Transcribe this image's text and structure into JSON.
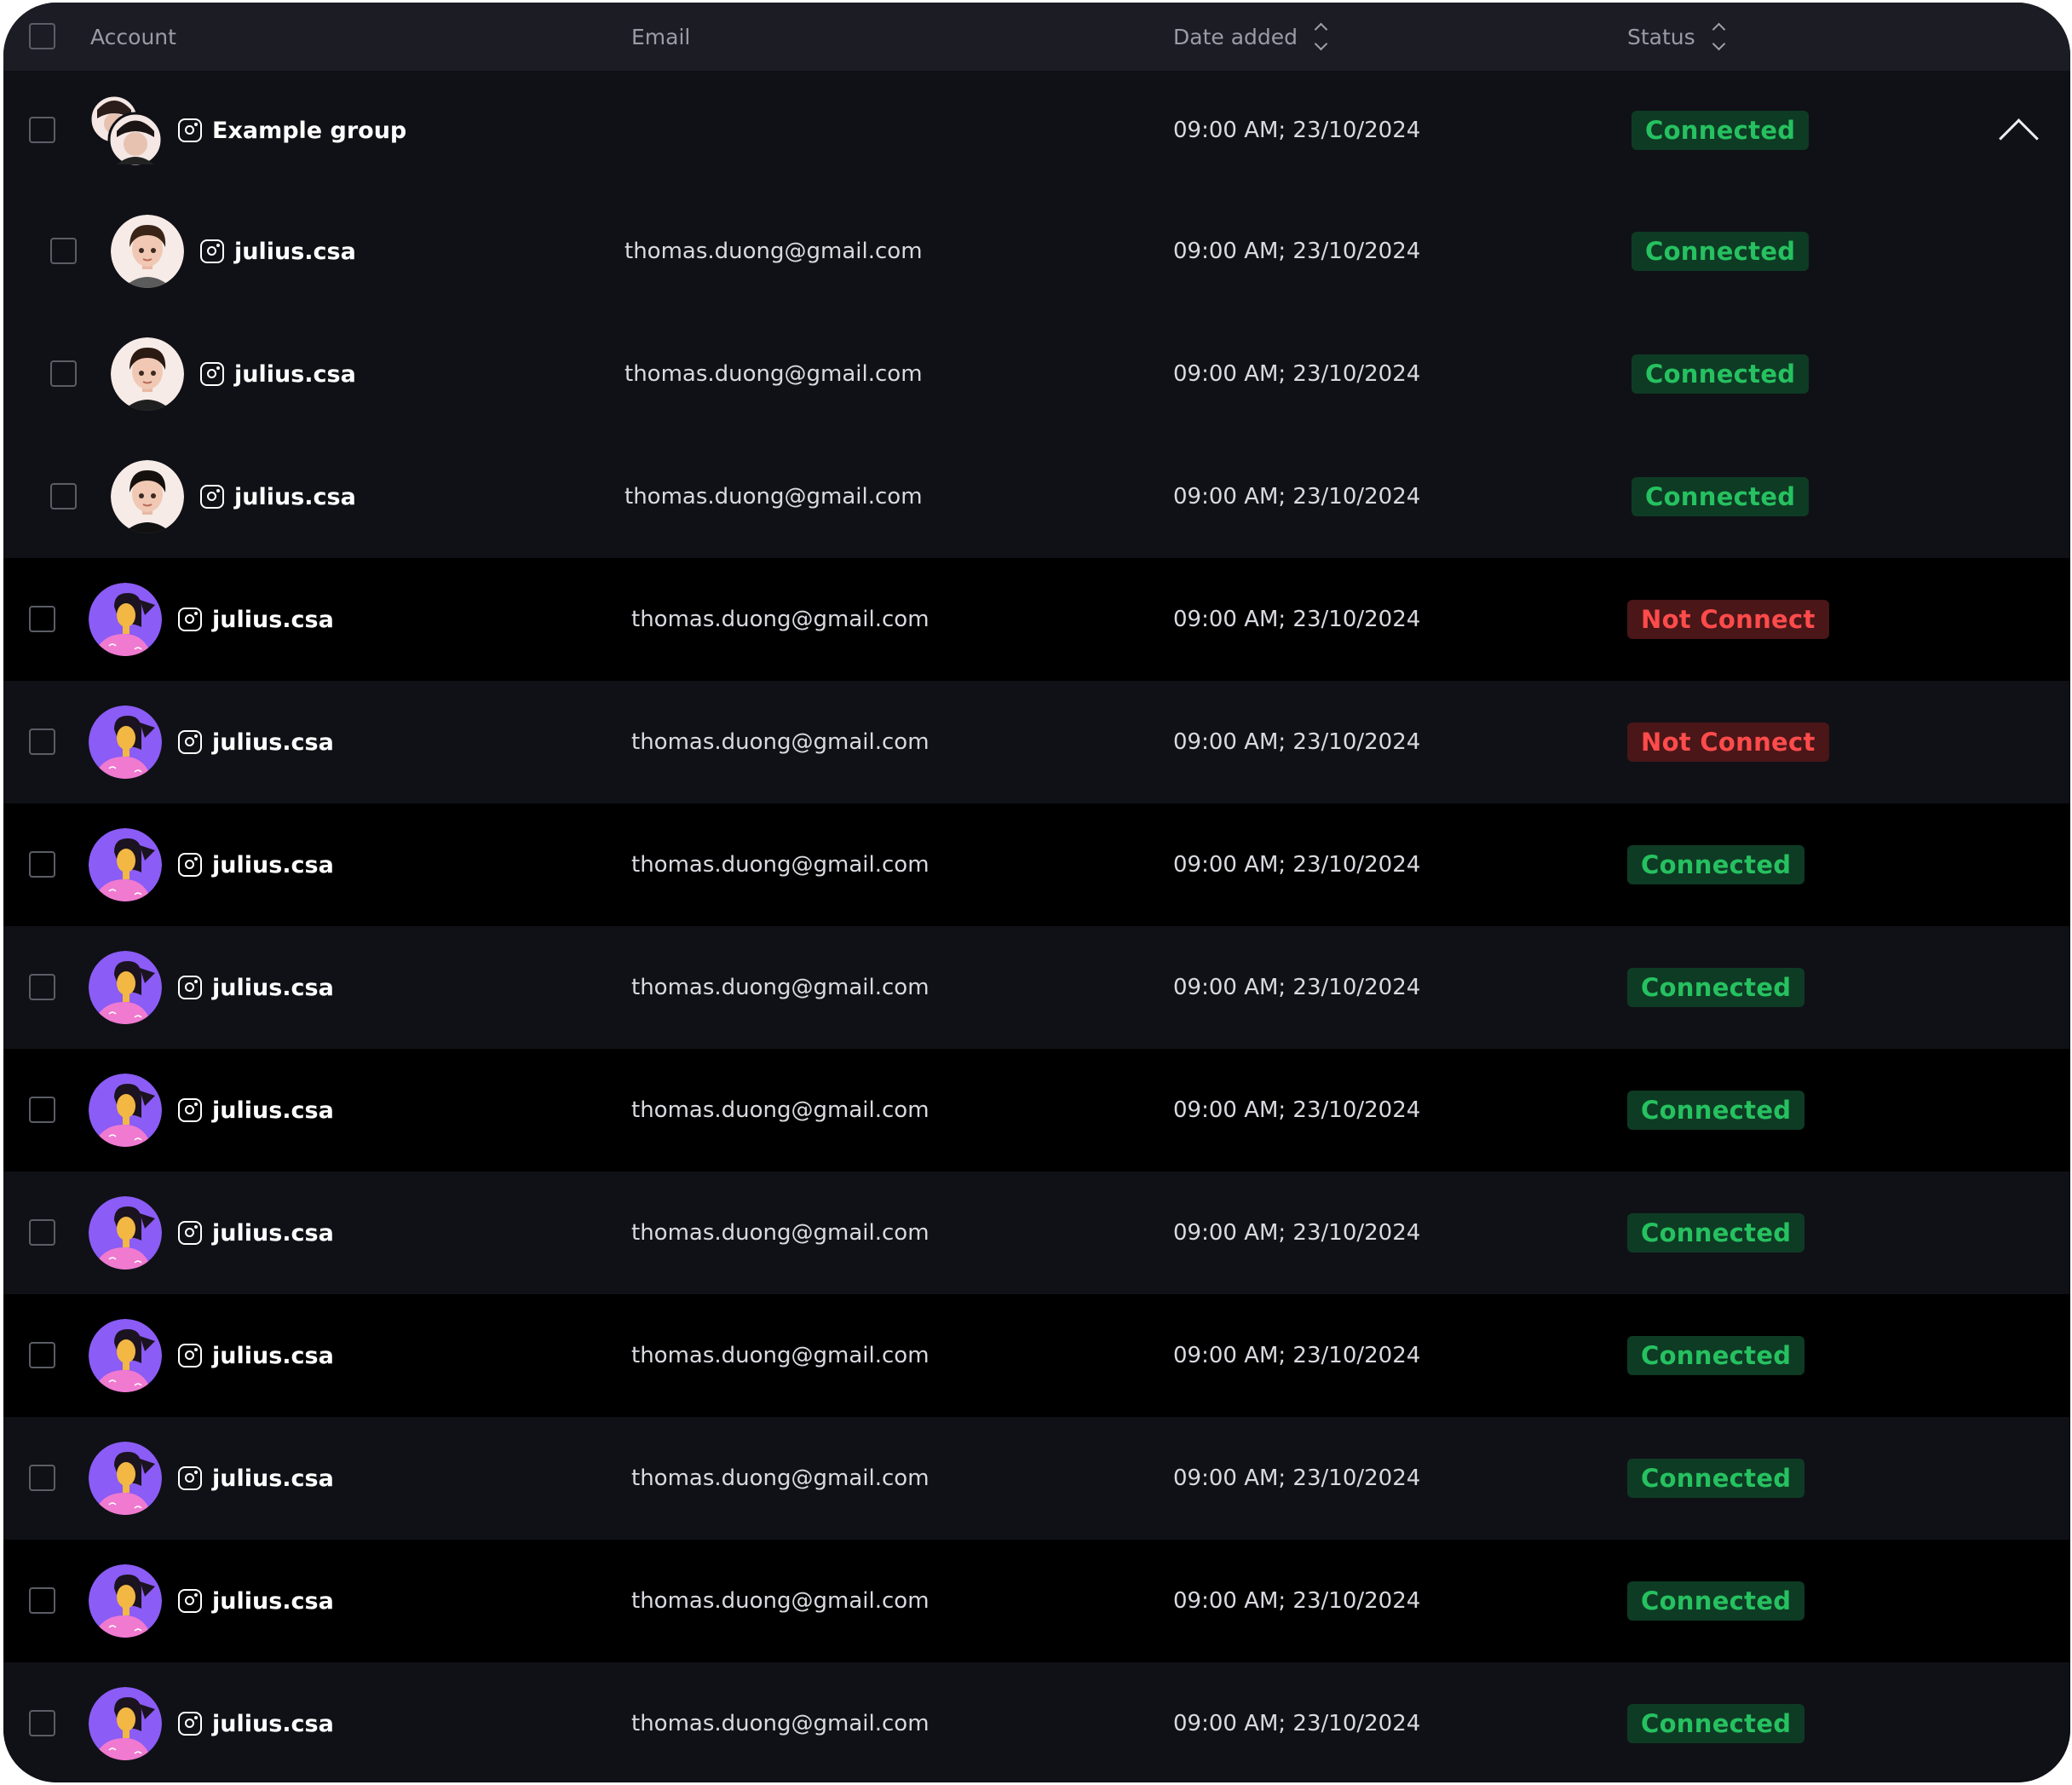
{
  "table": {
    "columns": {
      "account": "Account",
      "email": "Email",
      "date_added": "Date added",
      "status": "Status"
    },
    "group": {
      "name": "Example group",
      "date": "09:00 AM; 23/10/2024",
      "status": "Connected",
      "members": [
        {
          "username": "julius.csa",
          "email": "thomas.duong@gmail.com",
          "date": "09:00 AM; 23/10/2024",
          "status": "Connected"
        },
        {
          "username": "julius.csa",
          "email": "thomas.duong@gmail.com",
          "date": "09:00 AM; 23/10/2024",
          "status": "Connected"
        },
        {
          "username": "julius.csa",
          "email": "thomas.duong@gmail.com",
          "date": "09:00 AM; 23/10/2024",
          "status": "Connected"
        }
      ]
    },
    "rows": [
      {
        "username": "julius.csa",
        "email": "thomas.duong@gmail.com",
        "date": "09:00 AM; 23/10/2024",
        "status": "Not Connect"
      },
      {
        "username": "julius.csa",
        "email": "thomas.duong@gmail.com",
        "date": "09:00 AM; 23/10/2024",
        "status": "Not Connect"
      },
      {
        "username": "julius.csa",
        "email": "thomas.duong@gmail.com",
        "date": "09:00 AM; 23/10/2024",
        "status": "Connected"
      },
      {
        "username": "julius.csa",
        "email": "thomas.duong@gmail.com",
        "date": "09:00 AM; 23/10/2024",
        "status": "Connected"
      },
      {
        "username": "julius.csa",
        "email": "thomas.duong@gmail.com",
        "date": "09:00 AM; 23/10/2024",
        "status": "Connected"
      },
      {
        "username": "julius.csa",
        "email": "thomas.duong@gmail.com",
        "date": "09:00 AM; 23/10/2024",
        "status": "Connected"
      },
      {
        "username": "julius.csa",
        "email": "thomas.duong@gmail.com",
        "date": "09:00 AM; 23/10/2024",
        "status": "Connected"
      },
      {
        "username": "julius.csa",
        "email": "thomas.duong@gmail.com",
        "date": "09:00 AM; 23/10/2024",
        "status": "Connected"
      },
      {
        "username": "julius.csa",
        "email": "thomas.duong@gmail.com",
        "date": "09:00 AM; 23/10/2024",
        "status": "Connected"
      },
      {
        "username": "julius.csa",
        "email": "thomas.duong@gmail.com",
        "date": "09:00 AM; 23/10/2024",
        "status": "Connected"
      }
    ]
  },
  "colors": {
    "background": "#101116",
    "header": "#1c1d24",
    "row_alt": "#000000",
    "connected_text": "#26c160",
    "connected_bg": "#0e3b24",
    "not_connect_text": "#ff4b4b",
    "not_connect_bg": "#4a1618",
    "avatar_purple": "#8b5cf6"
  }
}
